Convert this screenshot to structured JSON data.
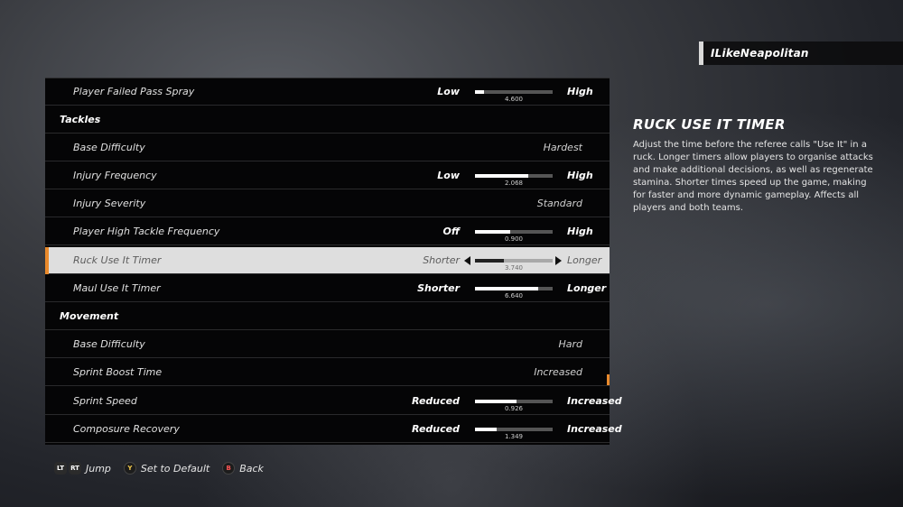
{
  "user": {
    "gamertag": "ILikeNeapolitan"
  },
  "info": {
    "title": "RUCK USE IT TIMER",
    "description": "Adjust the time before the referee calls \"Use It\" in a ruck. Longer timers allow players to organise attacks and make additional decisions, as well as regenerate stamina. Shorter times speed up the game, making for faster and more dynamic gameplay. Affects all players and both teams."
  },
  "rows": [
    {
      "name": "Player Failed Pass Spray",
      "low": "Low",
      "high": "High",
      "value": "4.600",
      "fill": 0.12
    },
    {
      "name": "Tackles"
    },
    {
      "name": "Base Difficulty",
      "setting": "Hardest"
    },
    {
      "name": "Injury Frequency",
      "low": "Low",
      "high": "High",
      "value": "2.068",
      "fill": 0.69
    },
    {
      "name": "Injury Severity",
      "setting": "Standard"
    },
    {
      "name": "Player High Tackle Frequency",
      "low": "Off",
      "high": "High",
      "value": "0.900",
      "fill": 0.45
    },
    {
      "name": "Ruck Use It Timer",
      "low": "Shorter",
      "high": "Longer",
      "value": "3.740",
      "fill": 0.37
    },
    {
      "name": "Maul Use It Timer",
      "low": "Shorter",
      "high": "Longer",
      "value": "6.640",
      "fill": 0.81
    },
    {
      "name": "Movement"
    },
    {
      "name": "Base Difficulty",
      "setting": "Hard"
    },
    {
      "name": "Sprint Boost Time",
      "setting": "Increased"
    },
    {
      "name": "Sprint Speed",
      "low": "Reduced",
      "high": "Increased",
      "value": "0.926",
      "fill": 0.53
    },
    {
      "name": "Composure Recovery",
      "low": "Reduced",
      "high": "Increased",
      "value": "1.349",
      "fill": 0.28
    }
  ],
  "footer": {
    "jump_lt": "LT",
    "jump_rt": "RT",
    "jump_label": "Jump",
    "default_key": "Y",
    "default_label": "Set to Default",
    "back_key": "B",
    "back_label": "Back"
  }
}
